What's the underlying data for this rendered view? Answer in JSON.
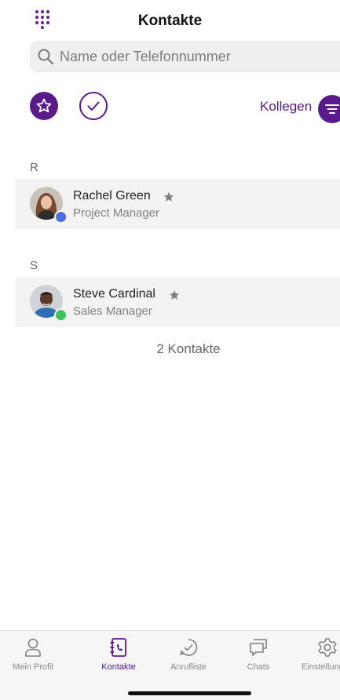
{
  "header": {
    "title": "Kontakte",
    "dialpad_icon": "dialpad-icon"
  },
  "search": {
    "placeholder": "Name oder Telefonnummer",
    "icon": "search-icon"
  },
  "filters": {
    "favorites_icon": "star-icon",
    "status_icon": "check-circle-icon",
    "group_label": "Kollegen",
    "group_icon": "filter-icon"
  },
  "colors": {
    "accent": "#5a1b8a",
    "presence_blue": "#4a6ee0",
    "presence_green": "#3ec25a"
  },
  "sections": [
    {
      "letter": "R",
      "contacts": [
        {
          "name": "Rachel Green",
          "role": "Project Manager",
          "favorite": true,
          "presence": "blue"
        }
      ]
    },
    {
      "letter": "S",
      "contacts": [
        {
          "name": "Steve Cardinal",
          "role": "Sales Manager",
          "favorite": true,
          "presence": "green"
        }
      ]
    }
  ],
  "count_label": "2 Kontakte",
  "tabbar": {
    "tabs": [
      {
        "label": "Mein Profil",
        "icon": "person-icon",
        "active": false
      },
      {
        "label": "Kontakte",
        "icon": "contacts-book-icon",
        "active": true
      },
      {
        "label": "Anrufliste",
        "icon": "call-history-icon",
        "active": false
      },
      {
        "label": "Chats",
        "icon": "chat-bubbles-icon",
        "active": false
      },
      {
        "label": "Einstellungen",
        "icon": "settings-icon",
        "active": false
      }
    ]
  }
}
